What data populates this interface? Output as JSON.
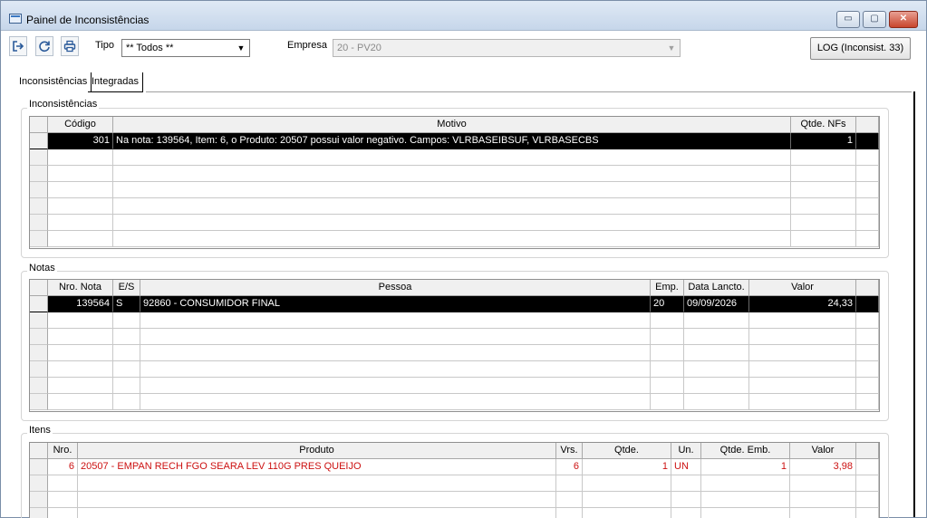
{
  "window": {
    "title": "Painel de Inconsistências",
    "min": "▭",
    "max": "▢",
    "close": "✕"
  },
  "toolbar": {
    "icons": [
      "exit-icon",
      "refresh-icon",
      "print-icon"
    ],
    "tipo_label": "Tipo",
    "tipo_value": "** Todos **",
    "empresa_label": "Empresa",
    "empresa_value": "20 - PV20",
    "log_button": "LOG (Inconsist. 33)"
  },
  "tabs": [
    "Inconsistências",
    "Integradas"
  ],
  "inconsistencias": {
    "title": "Inconsistências",
    "headers": [
      "Código",
      "Motivo",
      "Qtde. NFs"
    ],
    "rows": [
      [
        "301",
        "Na nota: 139564, Item: 6, o Produto: 20507 possui valor negativo. Campos: VLRBASEIBSUF, VLRBASECBS",
        "1"
      ]
    ]
  },
  "notas": {
    "title": "Notas",
    "headers": [
      "Nro. Nota",
      "E/S",
      "Pessoa",
      "Emp.",
      "Data Lancto.",
      "Valor"
    ],
    "rows": [
      [
        "139564",
        "S",
        "92860 - CONSUMIDOR FINAL",
        "20",
        "09/09/2026",
        "24,33"
      ]
    ]
  },
  "itens": {
    "title": "Itens",
    "headers": [
      "Nro.",
      "Produto",
      "Vrs.",
      "Qtde.",
      "Un.",
      "Qtde. Emb.",
      "Valor"
    ],
    "rows": [
      [
        "6",
        "20507 - EMPAN RECH FGO SEARA LEV 110G PRES QUEIJO",
        "6",
        "1",
        "UN",
        "1",
        "3,98"
      ]
    ]
  }
}
